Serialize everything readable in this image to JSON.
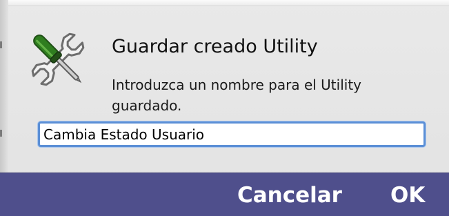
{
  "dialog": {
    "title": "Guardar creado Utility",
    "message": "Introduzca un nombre para el Utility guardado.",
    "icon": "tools-wrench-screwdriver-icon"
  },
  "name_field": {
    "value": "Cambia Estado Usuario"
  },
  "buttons": {
    "cancel_label": "Cancelar",
    "ok_label": "OK"
  },
  "colors": {
    "button_bar": "#4f4f8c",
    "focus_ring": "#5b8fd6",
    "screwdriver_handle": "#2f7d1f"
  }
}
